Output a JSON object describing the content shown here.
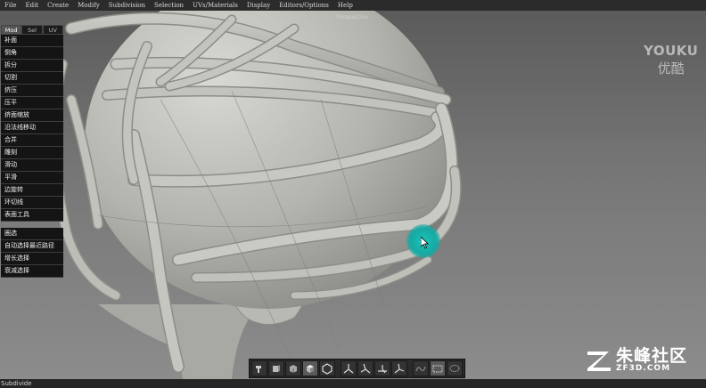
{
  "menubar": {
    "items": [
      "File",
      "Edit",
      "Create",
      "Modify",
      "Subdivision",
      "Selection",
      "UVs/Materials",
      "Display",
      "Editors/Options",
      "Help"
    ]
  },
  "viewport": {
    "label": "Perspective"
  },
  "left_panel": {
    "tabs": [
      "Mod",
      "Sel",
      "UV"
    ],
    "active_tab": "Mod",
    "tools": [
      "补面",
      "倒角",
      "拆分",
      "切割",
      "挤压",
      "压平",
      "挤面缩放",
      "沿法线移动",
      "合并",
      "雕刻",
      "滑动",
      "平滑",
      "边旋转",
      "环切线",
      "表面工具"
    ],
    "selection_tools": [
      "圈选",
      "自动选择最近路径",
      "增长选择",
      "衰减选择"
    ]
  },
  "bottom_toolbar": {
    "buttons": [
      {
        "icon": "hammer-icon",
        "selected": false
      },
      {
        "icon": "cube-front-icon",
        "selected": false
      },
      {
        "icon": "cube-side-icon",
        "selected": false
      },
      {
        "icon": "cube-shaded-icon",
        "selected": true
      },
      {
        "icon": "hexagon-icon",
        "selected": false
      },
      {
        "icon": "axis-tripod-icon",
        "selected": false
      },
      {
        "icon": "axis-tripod-tilt-icon",
        "selected": false
      },
      {
        "icon": "axis-tripod-flat-icon",
        "selected": false
      },
      {
        "icon": "axis-tripod-side-icon",
        "selected": false
      },
      {
        "icon": "lasso-curve-icon",
        "selected": false
      },
      {
        "icon": "marquee-rect-icon",
        "selected": true
      },
      {
        "icon": "lasso-dashed-icon",
        "selected": false
      }
    ]
  },
  "status_bar": {
    "text": "Subdivide"
  },
  "watermarks": {
    "youku_en": "YOUKU",
    "youku_cn": "优酷",
    "zf3d_cn": "朱峰社区",
    "zf3d_domain": "ZF3D.COM"
  },
  "colors": {
    "cursor_highlight": "#17a9a3",
    "panel_bg": "#141414",
    "menubar_bg": "#2b2b2b"
  }
}
